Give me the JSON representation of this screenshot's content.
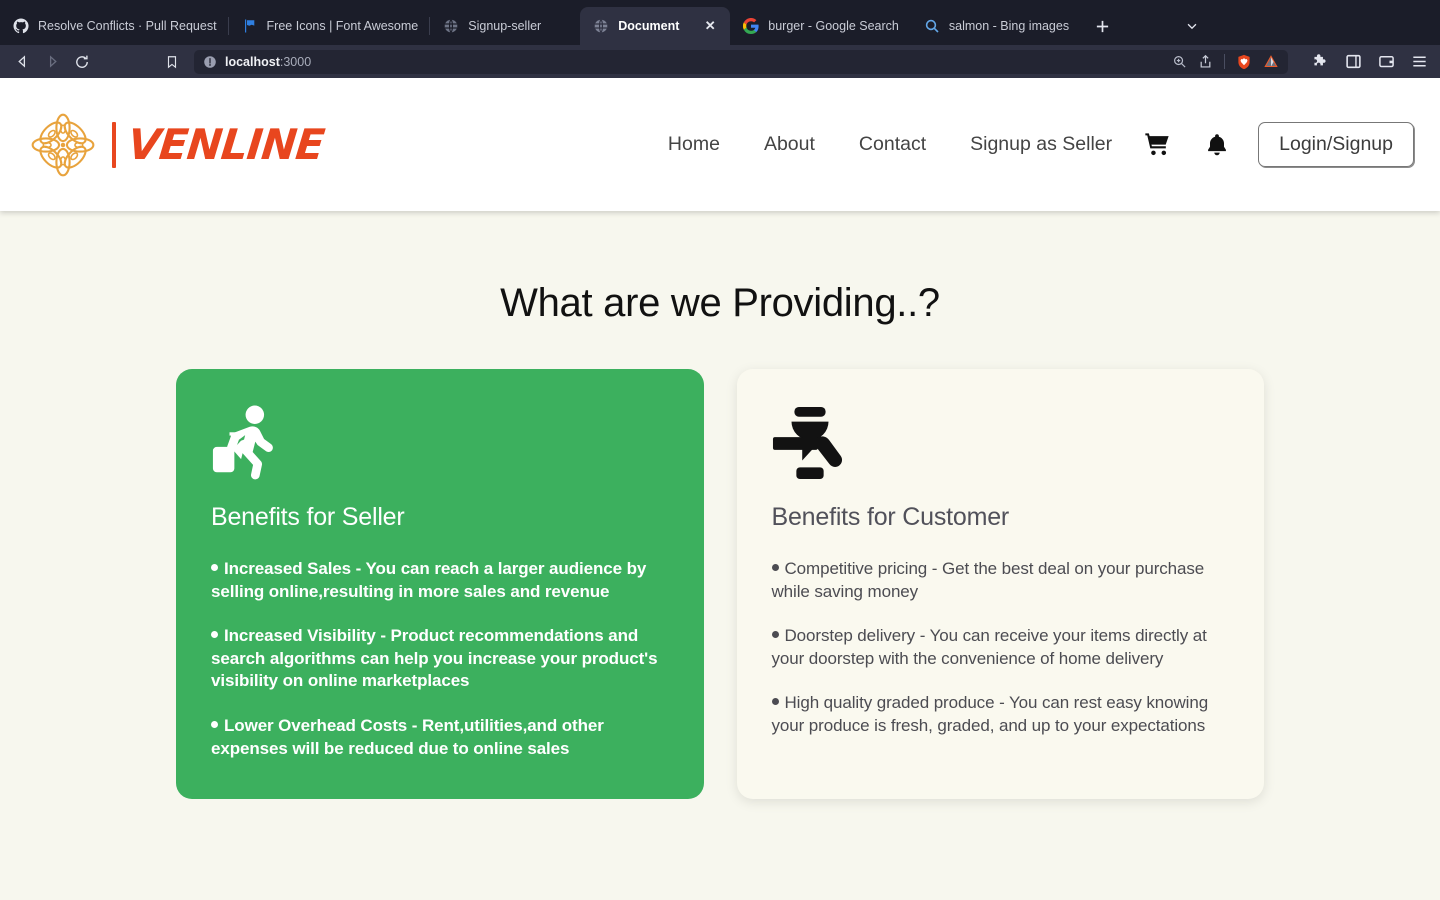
{
  "browser": {
    "tabs": [
      {
        "title": "Resolve Conflicts · Pull Request",
        "favicon": "github-icon",
        "active": false
      },
      {
        "title": "Free Icons | Font Awesome",
        "favicon": "fontawesome-flag-icon",
        "active": false
      },
      {
        "title": "Signup-seller",
        "favicon": "globe-icon",
        "active": false
      },
      {
        "title": "Document",
        "favicon": "globe-icon",
        "active": true
      },
      {
        "title": "burger - Google Search",
        "favicon": "google-icon",
        "active": false
      },
      {
        "title": "salmon - Bing images",
        "favicon": "search-icon",
        "active": false
      }
    ],
    "new_tab_label": "+",
    "tab_list_label": "⌄",
    "close_label": "✕",
    "toolbar": {
      "back_label": "◁",
      "forward_label": "▷",
      "reload_label": "⟳",
      "bookmark_label": "bookmark-icon",
      "url_display": "localhost:3000",
      "url_host": "localhost",
      "url_port": ":3000",
      "site_info_label": "site-info-icon",
      "zoom_label": "zoom-icon",
      "share_label": "share-icon",
      "brave_shields_label": "brave-shields-icon",
      "brave_rewards_label": "brave-rewards-icon",
      "extensions_label": "extensions-icon",
      "sidebar_label": "sidebar-icon",
      "wallet_label": "wallet-icon",
      "menu_label": "hamburger-menu-icon"
    },
    "theme": {
      "tabstrip_bg": "#1b1d29",
      "toolbar_bg": "#2f3142",
      "active_tab_bg": "#2f3142"
    }
  },
  "site": {
    "logo": {
      "word": "VENLINE",
      "mark": "flower-mandala-icon",
      "mark_color": "#e8a33d",
      "word_color": "#e8461e"
    },
    "nav": [
      {
        "label": "Home"
      },
      {
        "label": "About"
      },
      {
        "label": "Contact"
      },
      {
        "label": "Signup as Seller"
      }
    ],
    "cart_icon": "shopping-cart-icon",
    "bell_icon": "notification-bell-icon",
    "login_button": "Login/Signup"
  },
  "main": {
    "section_title": "What are we Providing..?",
    "background_color": "#f7f7ee",
    "cards": [
      {
        "variant": "green",
        "accent_color": "#3cb05e",
        "icon": "person-walking-with-luggage-icon",
        "title": "Benefits for Seller",
        "bullets": [
          "Increased Sales - You can reach a larger audience by selling online,resulting in more sales and revenue",
          "Increased Visibility - Product recommendations and search algorithms can help you increase your product's visibility on online marketplaces",
          "Lower Overhead Costs - Rent,utilities,and other expenses will be reduced due to online sales"
        ]
      },
      {
        "variant": "cream",
        "accent_color": "#faf9ef",
        "icon": "person-traffic-officer-pointing-icon",
        "title": "Benefits for Customer",
        "bullets": [
          "Competitive pricing - Get the best deal on your purchase while saving money",
          "Doorstep delivery - You can receive your items directly at your doorstep with the convenience of home delivery",
          "High quality graded produce - You can rest easy knowing your produce is fresh, graded, and up to your expectations"
        ]
      }
    ]
  }
}
